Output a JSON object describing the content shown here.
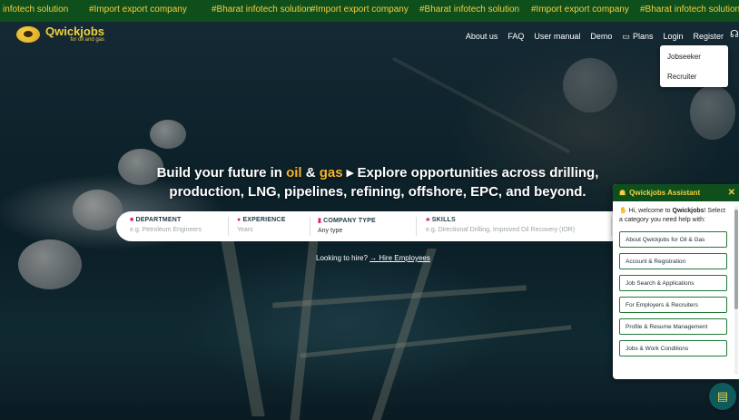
{
  "ticker": {
    "items": [
      "infotech solution",
      "#Import export company",
      "#Bharat infotech solution",
      "#Import export company",
      "#Bharat infotech solution",
      "#Import export company",
      "#Bharat infotech solution"
    ]
  },
  "brand": {
    "name": "Qwickjobs",
    "tagline": "for oil and gas"
  },
  "nav": {
    "about": "About us",
    "faq": "FAQ",
    "manual": "User manual",
    "demo": "Demo",
    "plans": "Plans",
    "login": "Login",
    "register": "Register"
  },
  "login_menu": {
    "jobseeker": "Jobseeker",
    "recruiter": "Recruiter"
  },
  "headline": {
    "part1": "Build your future in ",
    "oil": "oil",
    "amp": " & ",
    "gas": "gas",
    "arrow": " ▸ ",
    "part2": "Explore opportunities across drilling,",
    "line2": "production, LNG, pipelines, refining, offshore, EPC, and beyond."
  },
  "search": {
    "department": {
      "label": "DEPARTMENT",
      "placeholder": "e.g. Petroleum Engineers"
    },
    "experience": {
      "label": "EXPERIENCE",
      "placeholder": "Years"
    },
    "company_type": {
      "label": "COMPANY TYPE",
      "value": "Any type"
    },
    "skills": {
      "label": "SKILLS",
      "placeholder": "e.g. Directional Drilling, Improved Oil Recovery (IOR)"
    }
  },
  "hire": {
    "text": "Looking to hire? ",
    "link": "→ Hire Employees"
  },
  "assistant": {
    "title": "Qwickjobs Assistant",
    "greet_prefix": "Hi, welcome to ",
    "greet_brand": "Qwickjobs",
    "greet_suffix": "! Select a category you need help with:",
    "options": [
      "About Qwickjobs for Oil & Gas",
      "Account & Registration",
      "Job Search & Applications",
      "For Employers & Recruiters",
      "Profile & Resume Management",
      "Jobs & Work Conditions"
    ]
  },
  "colors": {
    "ticker_bg": "#0e4f1c",
    "ticker_text": "#f4cf3e",
    "accent": "#f4b42a",
    "assistant_border": "#1f7a38"
  },
  "icons": {
    "plans": "card-icon",
    "support": "headset-icon",
    "chat": "chat-icon"
  }
}
